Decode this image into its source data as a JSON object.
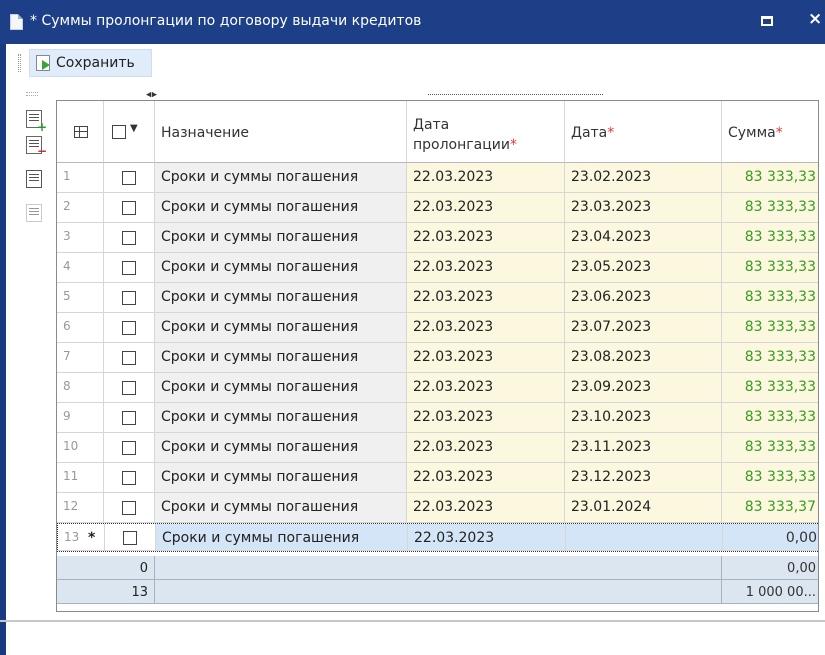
{
  "window": {
    "title": "* Суммы пролонгации по договору выдачи кредитов"
  },
  "toolbar": {
    "save_label": "Сохранить"
  },
  "icons": {
    "document": "document-icon",
    "save": "save-icon",
    "maximize": "maximize-icon",
    "close": "close-icon",
    "add_row": "add-row-icon",
    "delete_row": "delete-row-icon",
    "copy_row": "copy-row-icon",
    "paste_row": "paste-row-icon",
    "grid_settings": "grid-settings-icon"
  },
  "colors": {
    "titlebar": "#1c3f88",
    "required_mark": "#e03a3a",
    "amount_text": "#3a9a22",
    "date_cell_bg": "#fbf8df",
    "new_row_bg": "#d4e5f8",
    "footer_bg": "#dce6f0"
  },
  "grid": {
    "columns": {
      "purpose": "Назначение",
      "prolong_date": "Дата пролонгации",
      "date": "Дата",
      "amount": "Сумма",
      "required_mark": "*"
    },
    "rows": [
      {
        "n": "1",
        "purpose": "Сроки и суммы погашения",
        "prolong_date": "22.03.2023",
        "date": "23.02.2023",
        "amount": "83 333,33"
      },
      {
        "n": "2",
        "purpose": "Сроки и суммы погашения",
        "prolong_date": "22.03.2023",
        "date": "23.03.2023",
        "amount": "83 333,33"
      },
      {
        "n": "3",
        "purpose": "Сроки и суммы погашения",
        "prolong_date": "22.03.2023",
        "date": "23.04.2023",
        "amount": "83 333,33"
      },
      {
        "n": "4",
        "purpose": "Сроки и суммы погашения",
        "prolong_date": "22.03.2023",
        "date": "23.05.2023",
        "amount": "83 333,33"
      },
      {
        "n": "5",
        "purpose": "Сроки и суммы погашения",
        "prolong_date": "22.03.2023",
        "date": "23.06.2023",
        "amount": "83 333,33"
      },
      {
        "n": "6",
        "purpose": "Сроки и суммы погашения",
        "prolong_date": "22.03.2023",
        "date": "23.07.2023",
        "amount": "83 333,33"
      },
      {
        "n": "7",
        "purpose": "Сроки и суммы погашения",
        "prolong_date": "22.03.2023",
        "date": "23.08.2023",
        "amount": "83 333,33"
      },
      {
        "n": "8",
        "purpose": "Сроки и суммы погашения",
        "prolong_date": "22.03.2023",
        "date": "23.09.2023",
        "amount": "83 333,33"
      },
      {
        "n": "9",
        "purpose": "Сроки и суммы погашения",
        "prolong_date": "22.03.2023",
        "date": "23.10.2023",
        "amount": "83 333,33"
      },
      {
        "n": "10",
        "purpose": "Сроки и суммы погашения",
        "prolong_date": "22.03.2023",
        "date": "23.11.2023",
        "amount": "83 333,33"
      },
      {
        "n": "11",
        "purpose": "Сроки и суммы погашения",
        "prolong_date": "22.03.2023",
        "date": "23.12.2023",
        "amount": "83 333,33"
      },
      {
        "n": "12",
        "purpose": "Сроки и суммы погашения",
        "prolong_date": "22.03.2023",
        "date": "23.01.2024",
        "amount": "83 333,37"
      }
    ],
    "new_row": {
      "n": "13",
      "marker": "*",
      "purpose": "Сроки и суммы погашения",
      "prolong_date": "22.03.2023",
      "date": "",
      "amount": "0,00"
    },
    "footer": {
      "count_top": "0",
      "count_bottom": "13",
      "sum_top": "0,00",
      "sum_bottom": "1 000 00..."
    }
  }
}
